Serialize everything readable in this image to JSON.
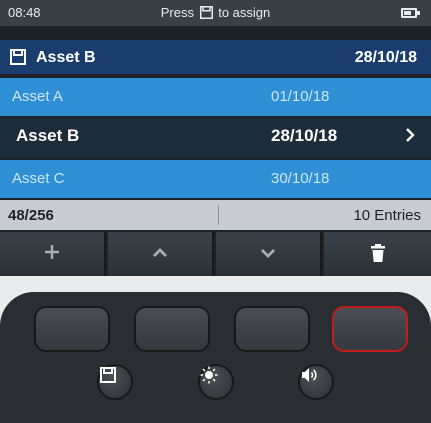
{
  "status_bar": {
    "time": "08:48",
    "hint_before": "Press",
    "hint_after": "to assign",
    "hint_icon": "save-icon",
    "battery_icon": "battery-icon"
  },
  "header": {
    "icon": "save-icon",
    "name": "Asset B",
    "date": "28/10/18"
  },
  "list": {
    "rows": [
      {
        "name": "Asset A",
        "date": "01/10/18",
        "selected": false
      },
      {
        "name": "Asset B",
        "date": "28/10/18",
        "selected": true
      },
      {
        "name": "Asset C",
        "date": "30/10/18",
        "selected": false
      }
    ]
  },
  "info_bar": {
    "count": "48/256",
    "entries": "10 Entries"
  },
  "softkeys": [
    {
      "icon": "plus-icon",
      "glyph": "+"
    },
    {
      "icon": "chevron-up-icon",
      "glyph": "⌃"
    },
    {
      "icon": "chevron-down-icon",
      "glyph": "⌄"
    },
    {
      "icon": "trash-icon",
      "glyph": "🗑"
    }
  ],
  "hardware": {
    "function_keys": 4,
    "highlighted_key_index": 3,
    "round_buttons": [
      "save-icon",
      "brightness-icon",
      "volume-icon"
    ]
  },
  "colors": {
    "header": "#1a3d6e",
    "list_row": "#2f8fd4",
    "selected_row": "#1c2c3b",
    "highlight_key": "#c21d1d"
  }
}
